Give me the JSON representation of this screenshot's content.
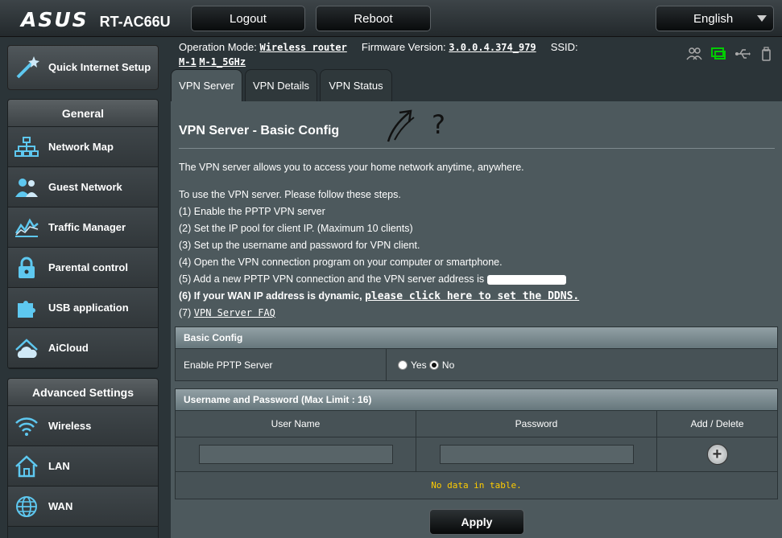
{
  "header": {
    "brand": "ASUS",
    "model": "RT-AC66U",
    "logout_label": "Logout",
    "reboot_label": "Reboot",
    "language": "English"
  },
  "info": {
    "operation_mode_label": "Operation Mode:",
    "operation_mode_value": "Wireless router",
    "firmware_label": "Firmware Version:",
    "firmware_value": "3.0.0.4.374_979",
    "ssid_label": "SSID:",
    "ssid_1": "M-1",
    "ssid_2": "M-1_5GHz"
  },
  "sidebar": {
    "quick_setup_label": "Quick Internet Setup",
    "general_header": "General",
    "general_items": [
      {
        "label": "Network Map",
        "icon": "network-map-icon"
      },
      {
        "label": "Guest Network",
        "icon": "guest-network-icon"
      },
      {
        "label": "Traffic Manager",
        "icon": "traffic-manager-icon"
      },
      {
        "label": "Parental control",
        "icon": "lock-icon"
      },
      {
        "label": "USB application",
        "icon": "puzzle-icon"
      },
      {
        "label": "AiCloud",
        "icon": "cloud-icon"
      }
    ],
    "advanced_header": "Advanced Settings",
    "advanced_items": [
      {
        "label": "Wireless",
        "icon": "wifi-icon"
      },
      {
        "label": "LAN",
        "icon": "home-icon"
      },
      {
        "label": "WAN",
        "icon": "globe-icon"
      }
    ]
  },
  "tabs": [
    {
      "label": "VPN Server",
      "active": true
    },
    {
      "label": "VPN Details",
      "active": false
    },
    {
      "label": "VPN Status",
      "active": false
    }
  ],
  "main": {
    "title": "VPN Server - Basic Config",
    "scribble": "?",
    "description": "The VPN server allows you to access your home network anytime, anywhere.",
    "steps_intro": "To use the VPN server. Please follow these steps.",
    "step1": "(1) Enable the PPTP VPN server",
    "step2": "(2) Set the IP pool for client IP. (Maximum 10 clients)",
    "step3": "(3) Set up the username and password for VPN client.",
    "step4": "(4) Open the VPN connection program on your computer or smartphone.",
    "step5": "(5) Add a new PPTP VPN connection and the VPN server address is",
    "step6_prefix": "(6) If your WAN IP address is dynamic,",
    "step6_link": "please click here to set the DDNS.",
    "step7_prefix": "(7)",
    "step7_link": "VPN Server FAQ"
  },
  "basic_config": {
    "header": "Basic Config",
    "enable_pptp_label": "Enable PPTP Server",
    "yes_label": "Yes",
    "no_label": "No",
    "selected": "No"
  },
  "accounts": {
    "header": "Username and Password (Max Limit : 16)",
    "col_username": "User Name",
    "col_password": "Password",
    "col_add_delete": "Add / Delete",
    "username_value": "",
    "password_value": "",
    "empty_message": "No data in table."
  },
  "apply_label": "Apply",
  "colors": {
    "panel_bg": "#4d595d",
    "page_bg": "#2b3438",
    "empty_text": "#ffcc00",
    "active_status_icon": "#00cc00"
  }
}
